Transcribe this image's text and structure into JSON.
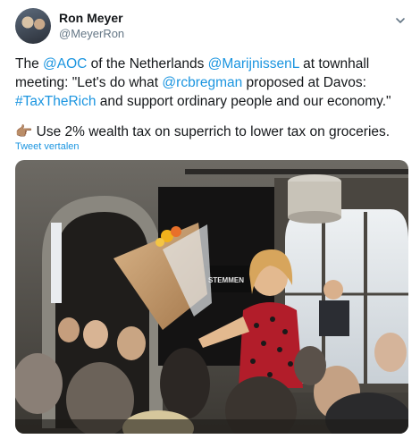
{
  "author": {
    "name": "Ron Meyer",
    "handle": "@MeyerRon"
  },
  "tweet": {
    "line1": {
      "t1": "The ",
      "m1": "@AOC",
      "t2": " of the Netherlands ",
      "m2": "@MarijnissenL",
      "t3": " at townhall meeting: \"Let's do what ",
      "m3": "@rcbregman",
      "t4": " proposed at Davos: ",
      "h1": "#TaxTheRich",
      "t5": " and support ordinary people and our economy.\""
    },
    "line2": {
      "emoji": "👉🏽",
      "text": " Use 2% wealth tax on superrich to lower tax on groceries."
    }
  },
  "translate_label": "Tweet vertalen",
  "media": {
    "icon": "photo",
    "sign_text": "STEMMEN"
  },
  "colors": {
    "link": "#1b95e0",
    "text": "#14171a",
    "secondary": "#657786"
  }
}
